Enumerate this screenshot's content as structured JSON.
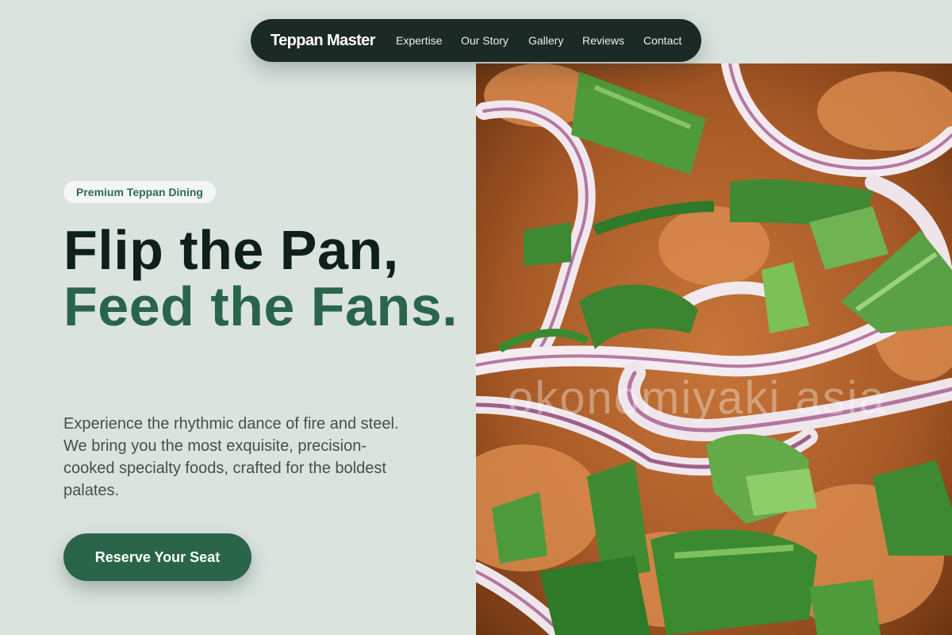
{
  "nav": {
    "brand": "Teppan Master",
    "links": [
      "Expertise",
      "Our Story",
      "Gallery",
      "Reviews",
      "Contact"
    ]
  },
  "hero": {
    "badge": "Premium Teppan Dining",
    "headline_line1": "Flip the Pan,",
    "headline_line2": "Feed the Fans.",
    "description": "Experience the rhythmic dance of fire and steel. We bring you the most exquisite, precision-cooked specialty foods, crafted for the boldest palates.",
    "cta_label": "Reserve Your Seat"
  },
  "image": {
    "watermark": "okonomiyaki asia"
  },
  "colors": {
    "page_bg": "#dbe3df",
    "nav_bg": "#1c2a26",
    "accent_green": "#2a6549",
    "headline_dark": "#0f1f1a"
  }
}
